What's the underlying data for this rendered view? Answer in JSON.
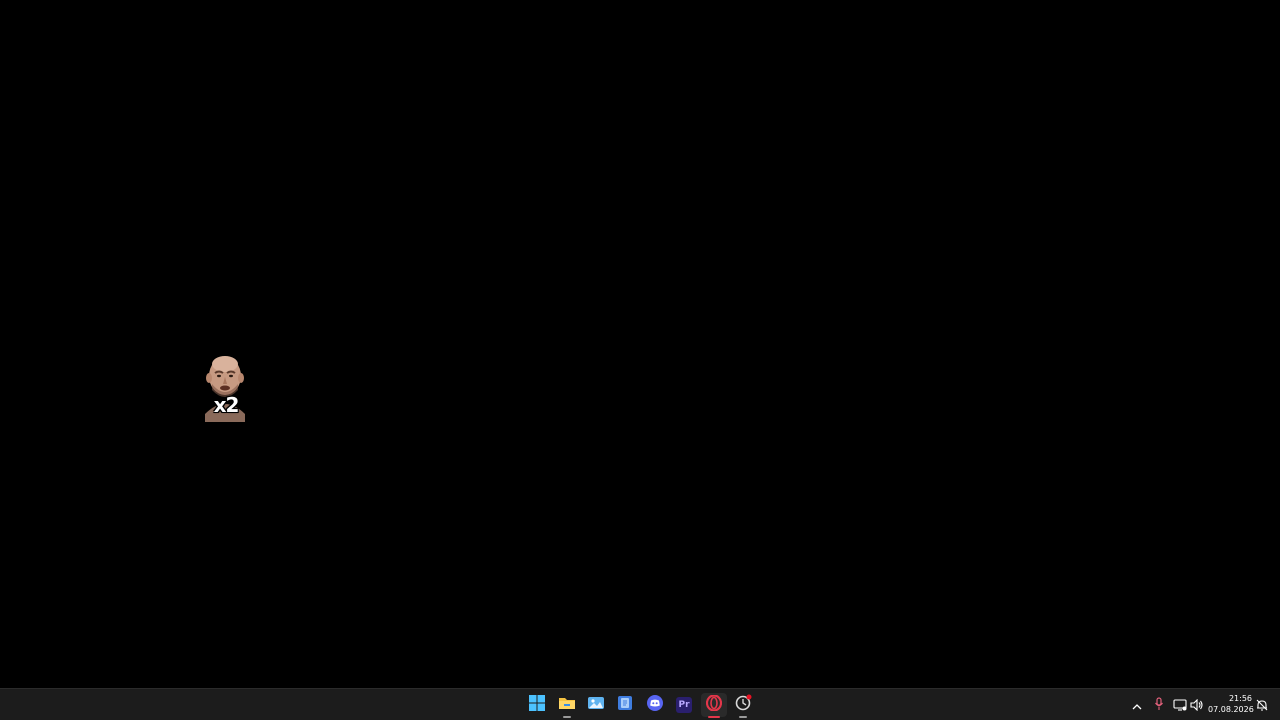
{
  "desktop": {
    "background_color": "#000000",
    "overlay_emote": {
      "icon": "face-emote-icon",
      "label": "x2"
    }
  },
  "taskbar": {
    "background_color": "#1c1c1c",
    "apps": [
      {
        "name": "Start",
        "icon": "windows-logo-icon"
      },
      {
        "name": "File Explorer",
        "icon": "folder-icon"
      },
      {
        "name": "Photos",
        "icon": "photos-icon"
      },
      {
        "name": "App",
        "icon": "blue-app-icon"
      },
      {
        "name": "Discord",
        "icon": "discord-icon"
      },
      {
        "name": "Premiere Pro",
        "icon": "premiere-pro-icon",
        "text": "Pr"
      },
      {
        "name": "Opera",
        "icon": "opera-icon",
        "active": true
      },
      {
        "name": "App",
        "icon": "settings-app-icon"
      }
    ],
    "tray": {
      "icons": [
        "chevron-up-icon",
        "microphone-icon",
        "network-icon",
        "volume-icon"
      ],
      "time": "21:56",
      "date": "07.08.2026",
      "notification_icon": "notification-bell-icon"
    },
    "accent_colors": {
      "opera_red": "#e3364a",
      "folder_yellow": "#f6c342",
      "start_blue": "#4cc2ff",
      "discord_blurple": "#5865f2",
      "premiere_purple": "#2a1f6e"
    }
  }
}
